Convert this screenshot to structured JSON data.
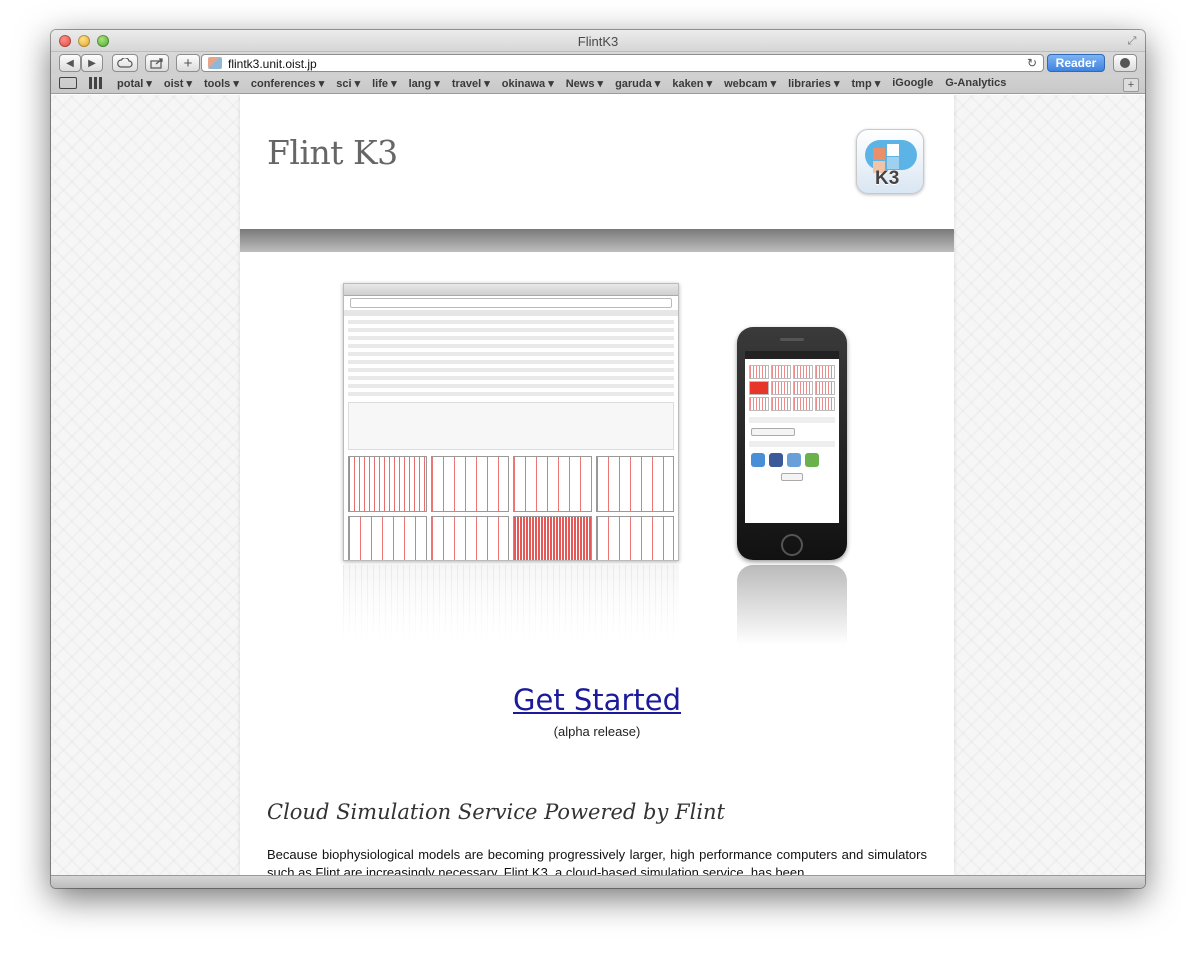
{
  "window": {
    "title": "FlintK3"
  },
  "toolbar": {
    "back_label": "◀",
    "forward_label": "▶",
    "url": "flintk3.unit.oist.jp",
    "reader_label": "Reader"
  },
  "bookmarks": [
    {
      "label": "potal ▾"
    },
    {
      "label": "oist ▾"
    },
    {
      "label": "tools ▾"
    },
    {
      "label": "conferences ▾"
    },
    {
      "label": "sci ▾"
    },
    {
      "label": "life ▾"
    },
    {
      "label": "lang ▾"
    },
    {
      "label": "travel ▾"
    },
    {
      "label": "okinawa ▾"
    },
    {
      "label": "News ▾"
    },
    {
      "label": "garuda ▾"
    },
    {
      "label": "kaken ▾"
    },
    {
      "label": "webcam ▾"
    },
    {
      "label": "libraries ▾"
    },
    {
      "label": "tmp ▾"
    },
    {
      "label": "iGoogle"
    },
    {
      "label": "G-Analytics"
    }
  ],
  "page": {
    "site_title": "Flint K3",
    "logo_text": "K3",
    "cta_label": "Get Started",
    "cta_sub": "(alpha release)",
    "section_title": "Cloud Simulation Service Powered by Flint",
    "body_text": "Because biophysiological models are becoming progressively larger, high performance computers and simulators such as Flint are increasingly necessary. Flint K3, a cloud-based simulation service, has been"
  },
  "colors": {
    "link": "#1a1a9a",
    "reader": "#3f82e0",
    "band": "#7a7a7a"
  }
}
